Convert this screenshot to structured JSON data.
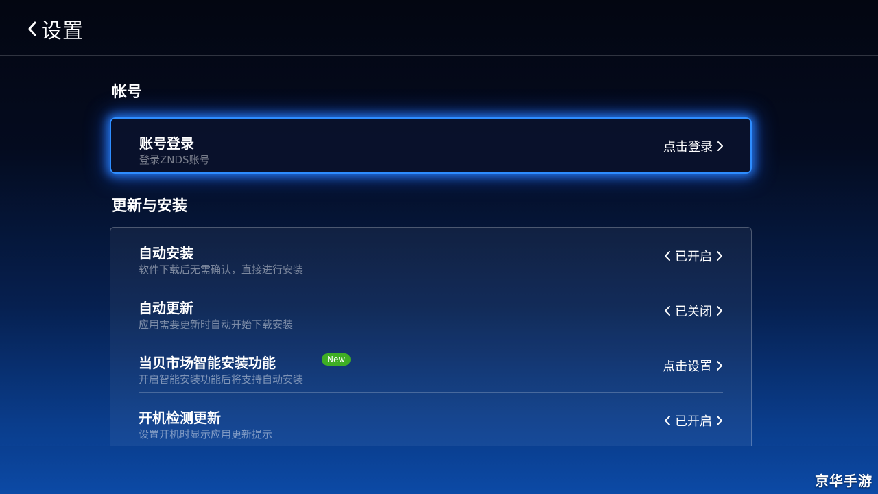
{
  "header": {
    "title": "设置"
  },
  "sections": {
    "account": {
      "title": "帐号",
      "row": {
        "label": "账号登录",
        "desc": "登录ZNDS账号",
        "value": "点击登录"
      }
    },
    "update": {
      "title": "更新与安装",
      "rows": [
        {
          "label": "自动安装",
          "desc": "软件下载后无需确认，直接进行安装",
          "value": "已开启"
        },
        {
          "label": "自动更新",
          "desc": "应用需要更新时自动开始下载安装",
          "value": "已关闭"
        },
        {
          "label": "当贝市场智能安装功能",
          "desc": "开启智能安装功能后将支持自动安装",
          "value": "点击设置",
          "badge": "New"
        },
        {
          "label": "开机检测更新",
          "desc": "设置开机时显示应用更新提示",
          "value": "已开启"
        }
      ]
    }
  },
  "watermark": "京华手游",
  "colors": {
    "focus_glow": "#2e8dff",
    "badge": "#3fae24"
  }
}
